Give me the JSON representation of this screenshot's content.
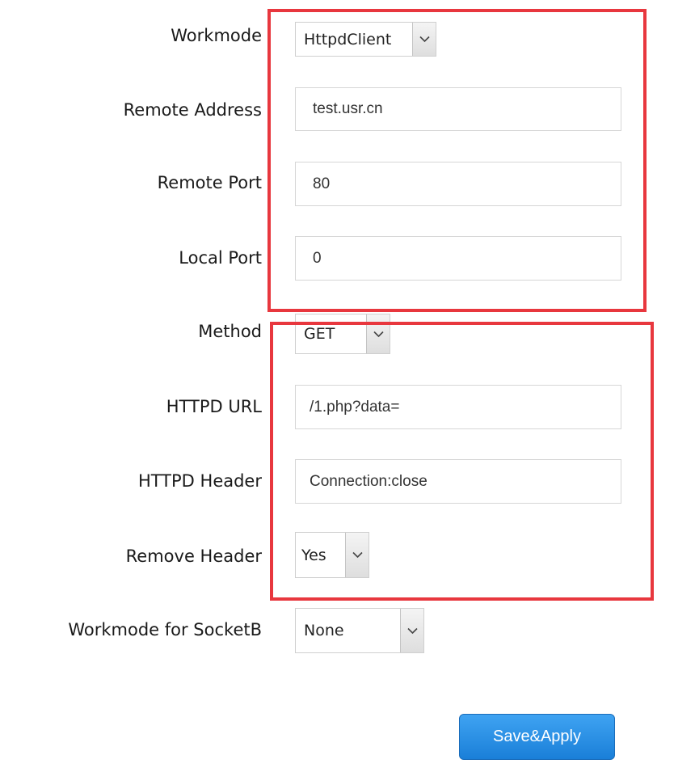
{
  "form": {
    "workmode": {
      "label": "Workmode",
      "value": "HttpdClient"
    },
    "remote_address": {
      "label": "Remote Address",
      "value": "test.usr.cn"
    },
    "remote_port": {
      "label": "Remote Port",
      "value": "80"
    },
    "local_port": {
      "label": "Local Port",
      "value": "0"
    },
    "method": {
      "label": "Method",
      "value": "GET"
    },
    "httpd_url": {
      "label": "HTTPD URL",
      "value": "/1.php?data="
    },
    "httpd_header": {
      "label": "HTTPD Header",
      "value": "Connection:close"
    },
    "remove_header": {
      "label": "Remove Header",
      "value": "Yes"
    },
    "workmode_socketb": {
      "label": "Workmode for SocketB",
      "value": "None"
    }
  },
  "actions": {
    "save_apply": "Save&Apply"
  },
  "colors": {
    "highlight_box": "#e8373e",
    "button": "#1a7fd8"
  }
}
